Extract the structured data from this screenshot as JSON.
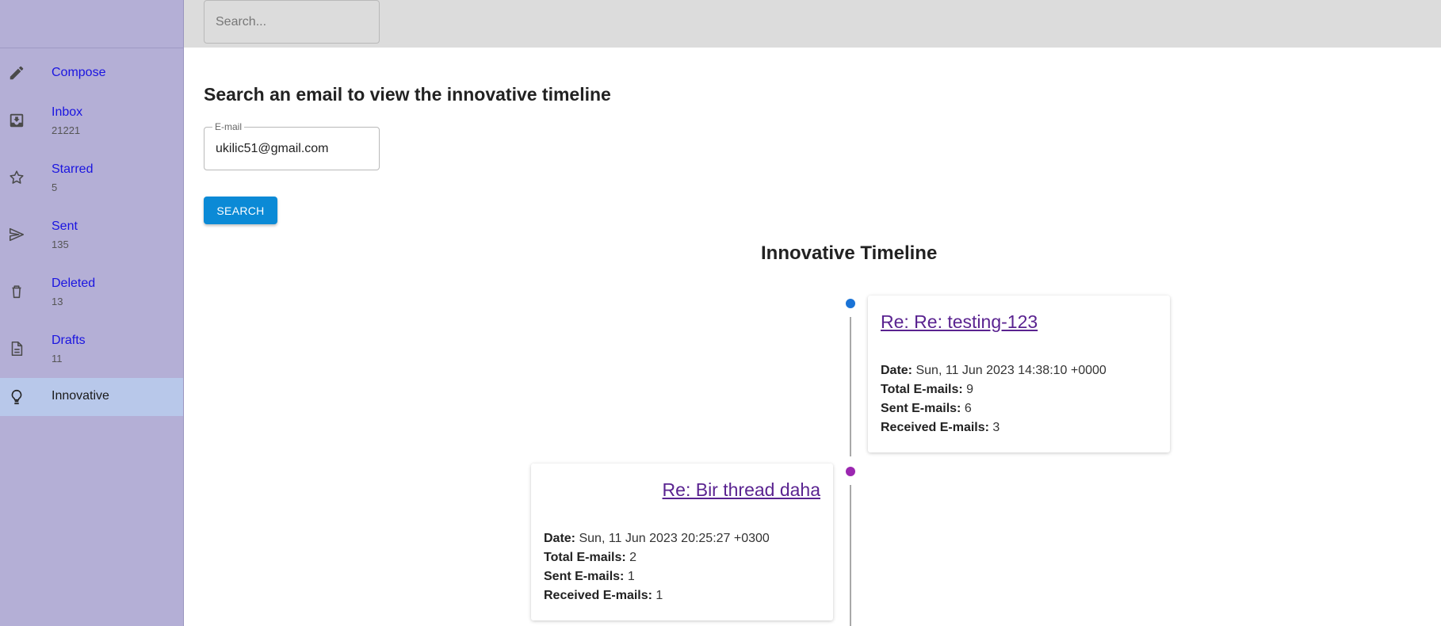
{
  "colors": {
    "sidebar_bg": "#b4afd6",
    "topbar_bg": "#dcdcdc",
    "active_item_bg": "#b8c8ea",
    "link_blue": "#1a14e0",
    "button_blue": "#0b8ad6",
    "dot_blue": "#1a73d6",
    "dot_purple": "#9b27b0",
    "card_link": "#5a2390"
  },
  "topbar": {
    "search_placeholder": "Search..."
  },
  "sidebar": {
    "items": [
      {
        "label": "Compose",
        "count": "",
        "icon": "pencil-icon"
      },
      {
        "label": "Inbox",
        "count": "21221",
        "icon": "inbox-icon"
      },
      {
        "label": "Starred",
        "count": "5",
        "icon": "star-icon"
      },
      {
        "label": "Sent",
        "count": "135",
        "icon": "send-icon"
      },
      {
        "label": "Deleted",
        "count": "13",
        "icon": "trash-icon"
      },
      {
        "label": "Drafts",
        "count": "11",
        "icon": "document-icon"
      },
      {
        "label": "Innovative",
        "count": "",
        "icon": "lightbulb-icon",
        "active": true
      }
    ]
  },
  "main": {
    "heading": "Search an email to view the innovative timeline",
    "email_field": {
      "label": "E-mail",
      "value": "ukilic51@gmail.com"
    },
    "search_button": "SEARCH",
    "timeline_title": "Innovative Timeline",
    "labels": {
      "date": "Date:",
      "total": "Total E-mails:",
      "sent": "Sent E-mails:",
      "received": "Received E-mails:"
    },
    "entries": [
      {
        "subject": "Re: Re: testing-123",
        "date": "Sun, 11 Jun 2023 14:38:10 +0000",
        "total": "9",
        "sent": "6",
        "received": "3",
        "side": "right",
        "dot_color": "blue"
      },
      {
        "subject": "Re: Bir thread daha",
        "date": "Sun, 11 Jun 2023 20:25:27 +0300",
        "total": "2",
        "sent": "1",
        "received": "1",
        "side": "left",
        "dot_color": "purple"
      }
    ]
  }
}
